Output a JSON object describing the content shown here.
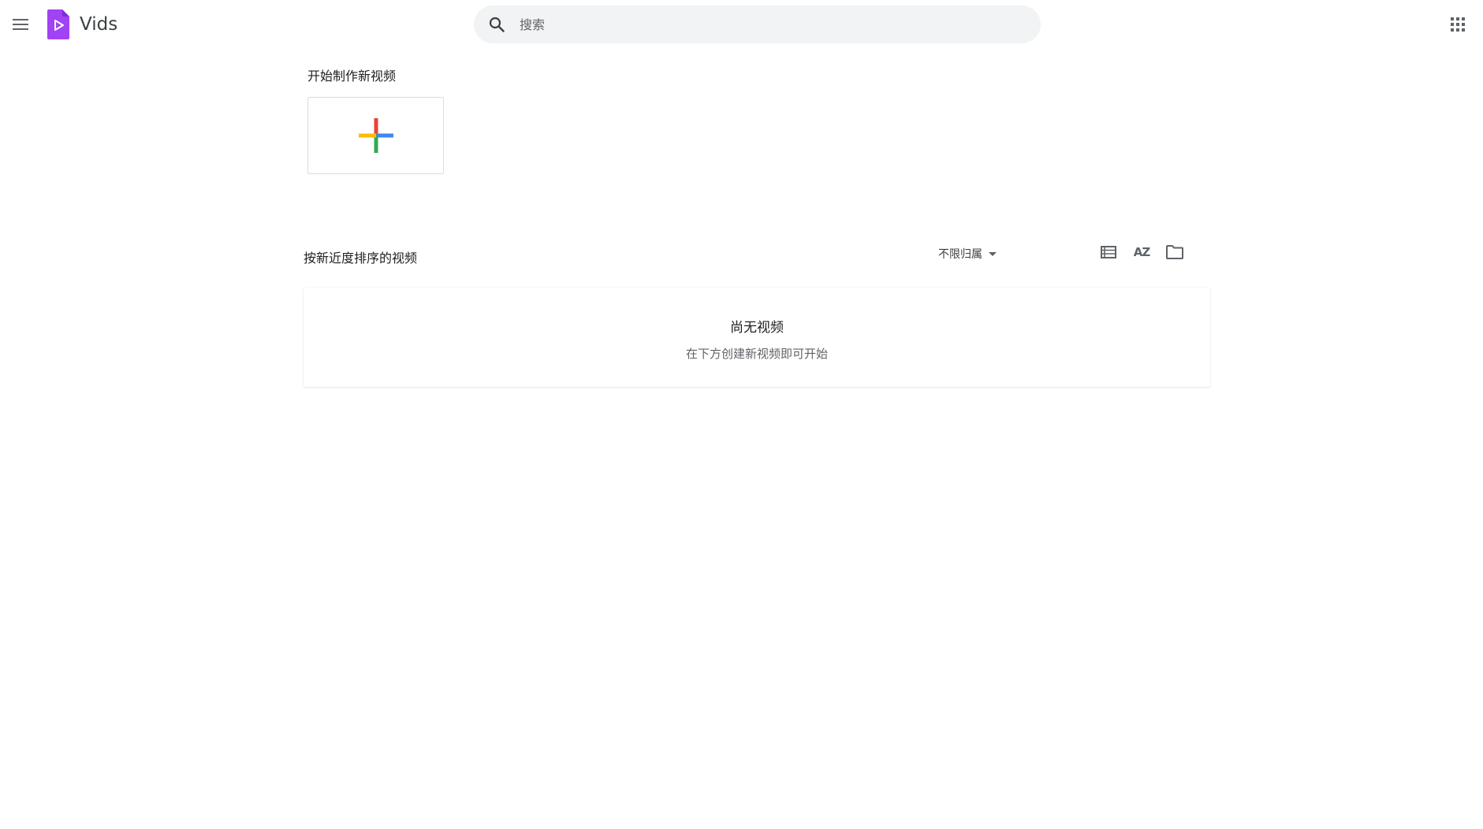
{
  "header": {
    "app_title": "Vids",
    "search_placeholder": "搜索"
  },
  "start_section": {
    "title": "开始制作新视频"
  },
  "recent_section": {
    "title": "按新近度排序的视频",
    "owner_filter": "不限归属",
    "sort_glyph": "AZ"
  },
  "empty_state": {
    "title": "尚无视频",
    "subtitle": "在下方创建新视频即可开始"
  },
  "colors": {
    "brand": "#a142f4",
    "plus_red": "#ea4335",
    "plus_blue": "#4285f4",
    "plus_green": "#34a853",
    "plus_yellow": "#fbbc04"
  }
}
